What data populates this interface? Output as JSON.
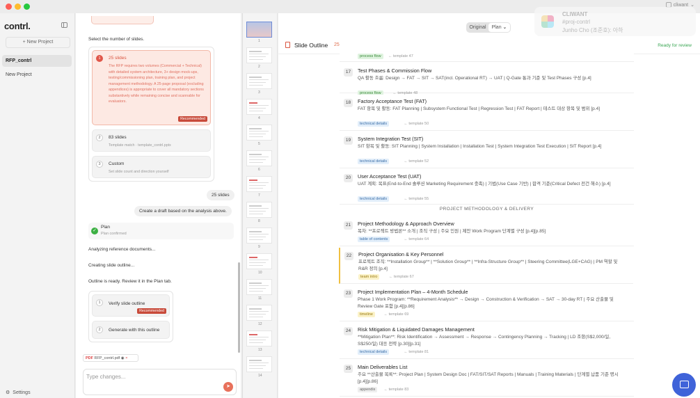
{
  "window": {
    "title": "contrl"
  },
  "header": {
    "toggle": [
      "Original",
      "Plan"
    ],
    "toggle_active": "Plan",
    "user": "cliwant"
  },
  "notification": {
    "title": "CLIWANT",
    "channel": "#proj-contrl",
    "message": "Junho Cho (조준호): 아하"
  },
  "sidebar": {
    "logo": "contrl.",
    "new_project": "+ New Project",
    "projects": [
      "RFP_contrl",
      "New Project"
    ],
    "settings": "Settings"
  },
  "chat": {
    "select_prompt": "Select the number of slides.",
    "options": [
      {
        "num": "1",
        "title": "25 slides",
        "desc": "The RFP requires two volumes (Commercial + Technical) with detailed system architecture, 3+ design mock-ups, testing/commissioning plan, training plan, and project management methodology. A 25-page proposal (excluding appendices) is appropriate to cover all mandatory sections substantively while remaining concise and scannable for evaluators.",
        "badge": "Recommended"
      },
      {
        "num": "2",
        "title": "83 slides",
        "desc": "Template match · template_contrl.pptx"
      },
      {
        "num": "3",
        "title": "Custom",
        "desc": "Set slide count and direction yourself"
      }
    ],
    "user_msg_1": "25 slides",
    "user_msg_2": "Create a draft based on the analysis above.",
    "plan_title": "Plan",
    "plan_sub": "Plan confirmed",
    "status_1": "Analyzing reference documents...",
    "status_2": "Creating slide outline...",
    "status_3": "Outline is ready. Review it in the Plan tab.",
    "next_options": [
      {
        "num": "1",
        "title": "Verify slide outline",
        "badge": "Recommended"
      },
      {
        "num": "2",
        "title": "Generate with this outline"
      }
    ],
    "attachment": "RFP_contrl.pdf",
    "attachment_type": "PDF",
    "input_placeholder": "Type changes..."
  },
  "thumbnails": [
    "1",
    "2",
    "3",
    "4",
    "5",
    "6",
    "7",
    "8",
    "9",
    "10",
    "11",
    "12",
    "13",
    "14"
  ],
  "outline": {
    "title": "Slide Outline",
    "count": "25",
    "status": "Ready for review",
    "partial_tag": "process flow",
    "partial_tpl": "← template 47",
    "section_label": "PROJECT METHODOLOGY & DELIVERY",
    "entries": [
      {
        "num": "17",
        "title": "Test Phases & Commission Flow",
        "desc": "QA 활동 흐름: Design → FAT → SIT → SAT(incl. Operational RT) → UAT | Q-Gate 통과 기준 및 Test Phases 구성 [p.4]",
        "tag": "process flow",
        "tpl": "← template 48"
      },
      {
        "num": "18",
        "title": "Factory Acceptance Test (FAT)",
        "desc": "FAT 항목 및 활동: FAT Planning | Subsystem Functional Test | Regression Test | FAT Report | 테스트 대상 항목 및 범위 [p.4]",
        "tag": "technical details",
        "tpl": "← template 50"
      },
      {
        "num": "19",
        "title": "System Integration Test (SIT)",
        "desc": "SIT 항목 및 활동: SIT Planning | System Installation | Installation Test | System Integration Test Execution | SIT Report [p.4]",
        "tag": "technical details",
        "tpl": "← template 52"
      },
      {
        "num": "20",
        "title": "User Acceptance Test (UAT)",
        "desc": "UAT 계획: 목표(End-to-End 솔루션 Marketing Requirement 충족) | 기법(Use Case 기반) | 합격 기준(Critical Defect 전건 해소) [p.4]",
        "tag": "technical details",
        "tpl": "← template 55"
      },
      {
        "num": "21",
        "title": "Project Methodology & Approach Overview",
        "desc": "목차: **프로젝트 방법론** 소개 | 조직 구성 | 주요 인원 | 제안 Work Program 단계별 구성 [p.4][p.85]",
        "tag": "table of contents",
        "tpl": "← template 64"
      },
      {
        "num": "22",
        "title": "Project Organisation & Key Personnel",
        "desc": "프로젝트 조직: **Installation Group** | **Solution Group** | **Infra-Structure Group** | Steering Committee(LGE+CAG) | PM 역할 및 R&R 정의 [p.4]",
        "tag": "team intro",
        "tpl": "← template 67"
      },
      {
        "num": "23",
        "title": "Project Implementation Plan – 4-Month Schedule",
        "desc": "Phase 1 Work Program: **Requirement Analysis** → Design → Construction & Verification → SAT → 30-day RT | 주요 산출물 및 Review Gate 포함 [p.4][p.86]",
        "tag": "timeline",
        "tpl": "← template 69"
      },
      {
        "num": "24",
        "title": "Risk Mitigation & Liquidated Damages Management",
        "desc": "**Mitigation Plan**: Risk Identification → Assessment → Response → Contingency Planning → Tracking | LD 조항(S$2,000/일, S$250/일) 대응 전략 [p.30][p.31]",
        "tag": "technical details",
        "tpl": "← template 81"
      },
      {
        "num": "25",
        "title": "Main Deliverables List",
        "desc": "주요 **산출물 목록**: Project Plan | System Design Doc | FAT/SIT/SAT Reports | Manuals | Training Materials | 단계별 납품 기준 명시 [p.4][p.86]",
        "tag": "appendix",
        "tpl": "← template 83"
      }
    ]
  }
}
